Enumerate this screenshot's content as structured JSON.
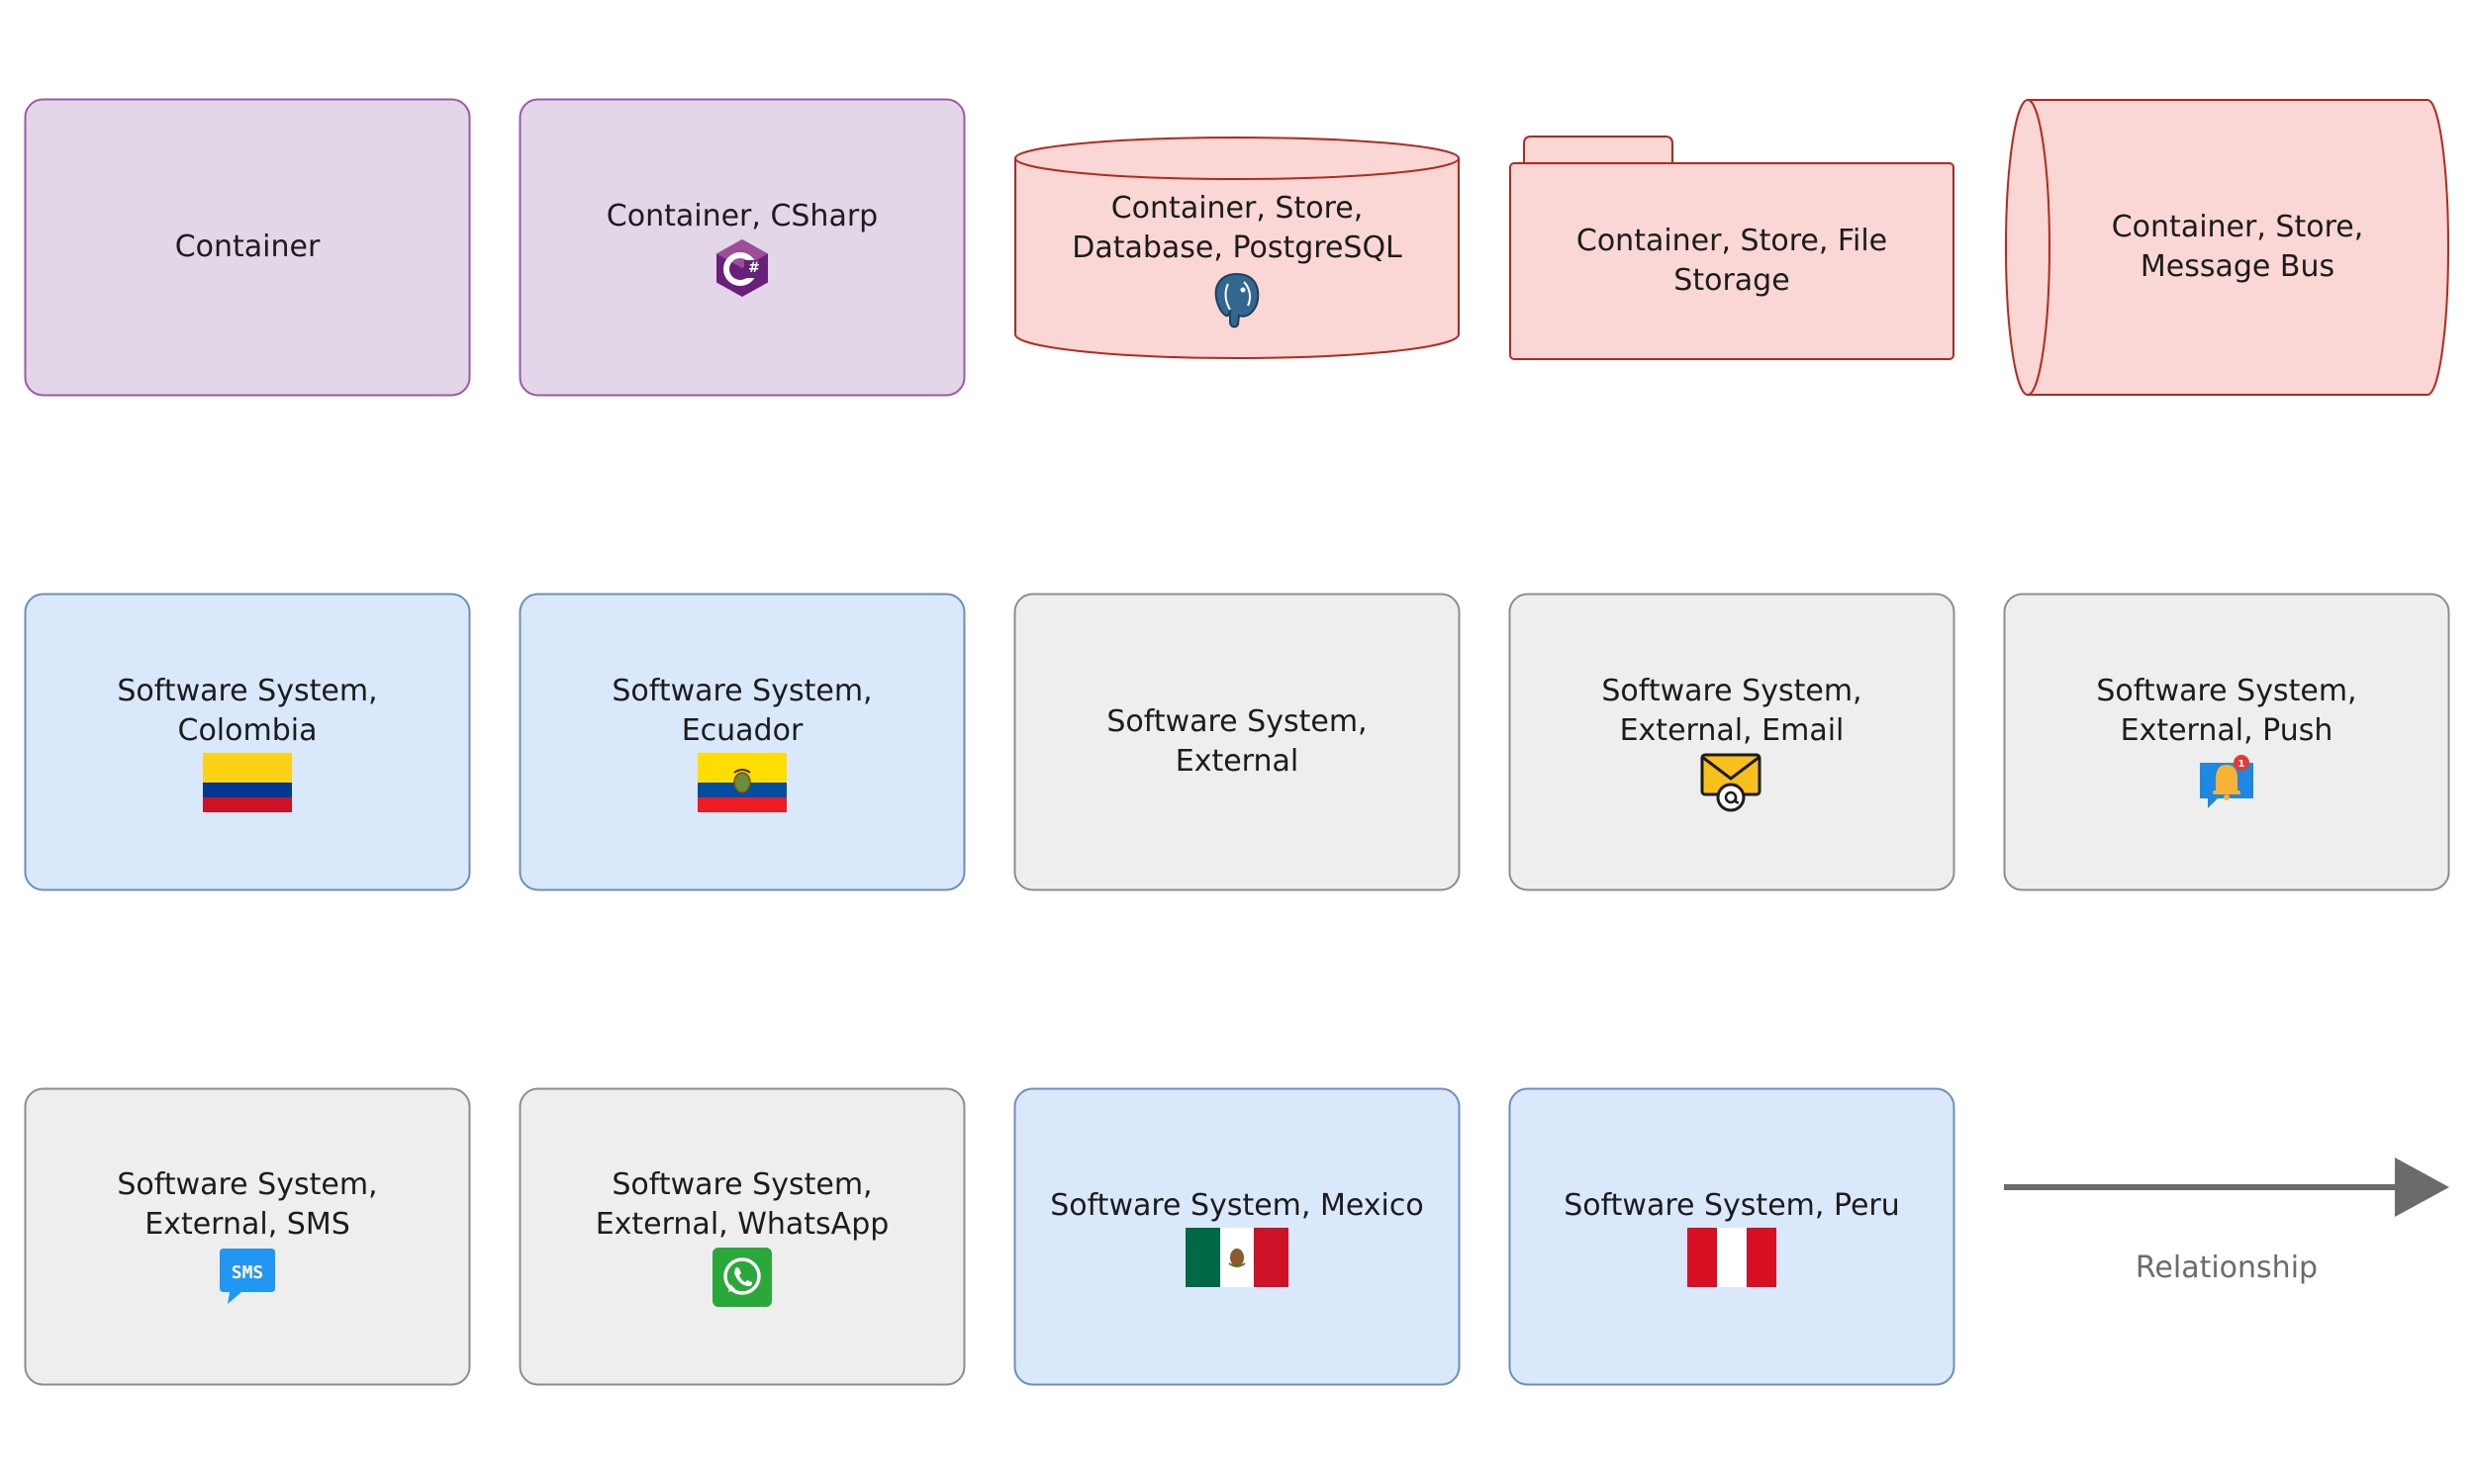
{
  "colors": {
    "container_fill": "#e3d6e8",
    "container_stroke": "#9b59a8",
    "store_fill": "#fad7d4",
    "store_stroke": "#b5281f",
    "internal_fill": "#dae8fb",
    "internal_stroke": "#6c8ebf",
    "external_fill": "#eeeeee",
    "external_stroke": "#8d8d8d",
    "relationship_stroke": "#6b6b6b"
  },
  "shapes": {
    "container": {
      "label": "Container"
    },
    "container_csharp": {
      "label": "Container, CSharp",
      "icon": "csharp-icon"
    },
    "store_database": {
      "label": "Container, Store,\nDatabase, PostgreSQL",
      "icon": "postgresql-icon"
    },
    "store_file": {
      "label": "Container, Store, File\nStorage"
    },
    "store_message_bus": {
      "label": "Container, Store,\nMessage Bus"
    },
    "system_colombia": {
      "label": "Software System,\nColombia",
      "icon": "colombia-flag-icon"
    },
    "system_ecuador": {
      "label": "Software System,\nEcuador",
      "icon": "ecuador-flag-icon"
    },
    "system_external": {
      "label": "Software System,\nExternal"
    },
    "system_email": {
      "label": "Software System,\nExternal, Email",
      "icon": "email-icon"
    },
    "system_push": {
      "label": "Software System,\nExternal, Push",
      "icon": "push-notification-icon"
    },
    "system_sms": {
      "label": "Software System,\nExternal, SMS",
      "icon": "sms-icon"
    },
    "system_whatsapp": {
      "label": "Software System,\nExternal, WhatsApp",
      "icon": "whatsapp-icon"
    },
    "system_mexico": {
      "label": "Software System, Mexico",
      "icon": "mexico-flag-icon"
    },
    "system_peru": {
      "label": "Software System, Peru",
      "icon": "peru-flag-icon"
    }
  },
  "relationship": {
    "label": "Relationship"
  }
}
